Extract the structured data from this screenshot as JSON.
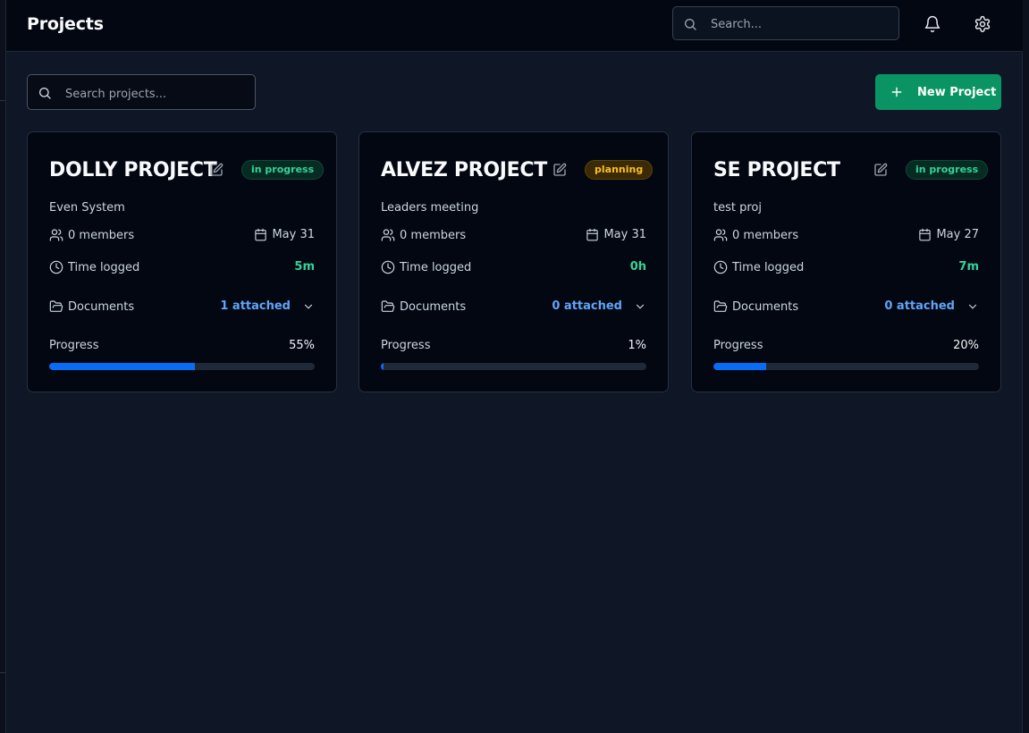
{
  "header": {
    "title": "Projects",
    "search_placeholder": "Search...",
    "bell_icon": "bell-icon",
    "settings_icon": "gear-icon"
  },
  "toolbar": {
    "search_placeholder": "Search projects...",
    "new_project_label": "New Project"
  },
  "labels": {
    "time_logged": "Time logged",
    "documents": "Documents",
    "progress": "Progress"
  },
  "colors": {
    "accent_green": "#0a9463",
    "progress_blue": "#0a6cf5",
    "status_in_progress": "#34d399",
    "status_planning": "#fbbf24",
    "link_blue": "#60a5fa"
  },
  "projects": [
    {
      "name": "DOLLY PROJECT",
      "status": "in progress",
      "status_type": "in-progress",
      "description": "Even System",
      "members": "0 members",
      "date": "May 31",
      "time_logged": "5m",
      "documents": "1 attached",
      "progress_text": "55%",
      "progress": 55
    },
    {
      "name": "ALVEZ PROJECT",
      "status": "planning",
      "status_type": "planning",
      "description": "Leaders meeting",
      "members": "0 members",
      "date": "May 31",
      "time_logged": "0h",
      "documents": "0 attached",
      "progress_text": "1%",
      "progress": 1
    },
    {
      "name": "SE PROJECT",
      "status": "in progress",
      "status_type": "in-progress",
      "description": "test proj",
      "members": "0 members",
      "date": "May 27",
      "time_logged": "7m",
      "documents": "0 attached",
      "progress_text": "20%",
      "progress": 20
    }
  ]
}
